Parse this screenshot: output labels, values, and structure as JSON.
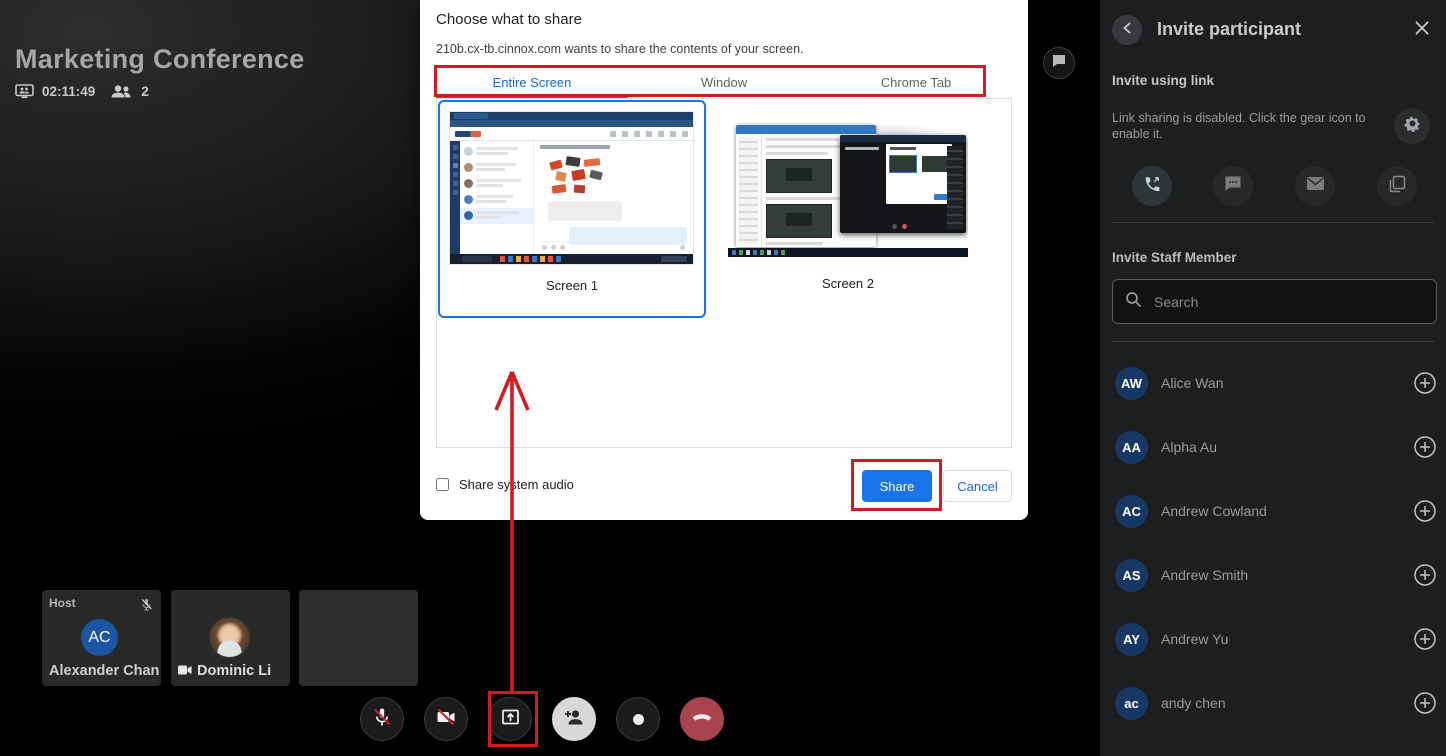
{
  "meeting": {
    "title": "Marketing Conference",
    "timer": "02:11:49",
    "participant_count": "2"
  },
  "share_dialog": {
    "title": "Choose what to share",
    "subtitle": "210b.cx-tb.cinnox.com wants to share the contents of your screen.",
    "tabs": [
      {
        "label": "Entire Screen",
        "active": true
      },
      {
        "label": "Window",
        "active": false
      },
      {
        "label": "Chrome Tab",
        "active": false
      }
    ],
    "screens": [
      {
        "label": "Screen 1",
        "selected": true
      },
      {
        "label": "Screen 2",
        "selected": false
      }
    ],
    "audio_checkbox_label": "Share system audio",
    "share_button": "Share",
    "cancel_button": "Cancel"
  },
  "sidebar": {
    "title": "Invite participant",
    "link_section": {
      "heading": "Invite using link",
      "message": "Link sharing is disabled. Click the gear icon to enable it."
    },
    "invite_icons": [
      "call-out-icon",
      "sms-icon",
      "email-icon",
      "copy-link-icon"
    ],
    "staff_section": {
      "heading": "Invite Staff Member",
      "search_placeholder": "Search",
      "members": [
        {
          "initials": "AW",
          "name": "Alice Wan"
        },
        {
          "initials": "AA",
          "name": "Alpha Au"
        },
        {
          "initials": "AC",
          "name": "Andrew Cowland"
        },
        {
          "initials": "AS",
          "name": "Andrew Smith"
        },
        {
          "initials": "AY",
          "name": "Andrew Yu"
        },
        {
          "initials": "ac",
          "name": "andy chen"
        }
      ]
    }
  },
  "participants": {
    "host_label": "Host",
    "tiles": [
      {
        "initials": "AC",
        "name": "Alexander Chan",
        "role": "Host",
        "mic_muted": true
      },
      {
        "name": "Dominic Li",
        "camera_on": true
      },
      {
        "name": ""
      }
    ]
  },
  "toolbar": {
    "buttons": [
      "mic-muted",
      "camera-off",
      "share-screen",
      "add-participant",
      "record",
      "hang-up"
    ]
  },
  "annotations": {
    "color": "#d71920",
    "highlighted": [
      "share-dialog-tabs",
      "share-button",
      "toolbar-share-screen-button"
    ],
    "arrow": "from toolbar share-screen button up to dialog"
  },
  "colors": {
    "accent_blue": "#1a73e8",
    "sidebar_bg": "#1d1e20",
    "hangup_red": "#a9434e",
    "avatar_navy": "#173864",
    "avatar_blue": "#1c55a3"
  }
}
